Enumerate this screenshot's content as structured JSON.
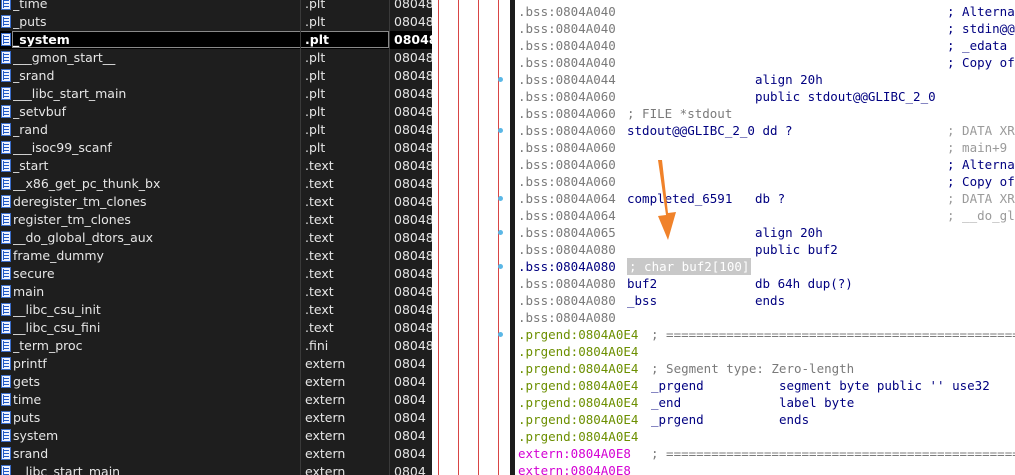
{
  "functions": [
    {
      "name": "_time",
      "segment": ".plt",
      "address": "08048"
    },
    {
      "name": "_puts",
      "segment": ".plt",
      "address": "08048"
    },
    {
      "name": "_system",
      "segment": ".plt",
      "address": "08048",
      "selected": true
    },
    {
      "name": "___gmon_start__",
      "segment": ".plt",
      "address": "08048"
    },
    {
      "name": "_srand",
      "segment": ".plt",
      "address": "08048"
    },
    {
      "name": "___libc_start_main",
      "segment": ".plt",
      "address": "08048"
    },
    {
      "name": "_setvbuf",
      "segment": ".plt",
      "address": "08048"
    },
    {
      "name": "_rand",
      "segment": ".plt",
      "address": "08048"
    },
    {
      "name": "___isoc99_scanf",
      "segment": ".plt",
      "address": "08048"
    },
    {
      "name": "_start",
      "segment": ".text",
      "address": "08048"
    },
    {
      "name": "__x86_get_pc_thunk_bx",
      "segment": ".text",
      "address": "08048"
    },
    {
      "name": "deregister_tm_clones",
      "segment": ".text",
      "address": "08048"
    },
    {
      "name": "register_tm_clones",
      "segment": ".text",
      "address": "08048"
    },
    {
      "name": "__do_global_dtors_aux",
      "segment": ".text",
      "address": "08048"
    },
    {
      "name": "frame_dummy",
      "segment": ".text",
      "address": "08048"
    },
    {
      "name": "secure",
      "segment": ".text",
      "address": "08048"
    },
    {
      "name": "main",
      "segment": ".text",
      "address": "08048"
    },
    {
      "name": "__libc_csu_init",
      "segment": ".text",
      "address": "08048"
    },
    {
      "name": "__libc_csu_fini",
      "segment": ".text",
      "address": "08048"
    },
    {
      "name": "_term_proc",
      "segment": ".fini",
      "address": "08048"
    },
    {
      "name": "printf",
      "segment": "extern",
      "address": "0804"
    },
    {
      "name": "gets",
      "segment": "extern",
      "address": "0804"
    },
    {
      "name": "time",
      "segment": "extern",
      "address": "0804"
    },
    {
      "name": "puts",
      "segment": "extern",
      "address": "0804"
    },
    {
      "name": "system",
      "segment": "extern",
      "address": "0804"
    },
    {
      "name": "srand",
      "segment": "extern",
      "address": "0804"
    },
    {
      "name": "__libc_start_main",
      "segment": "extern",
      "address": "0804"
    }
  ],
  "listing": [
    {
      "addr": ".bss:0804A040",
      "kind": "bss",
      "cmt": "; Alterna"
    },
    {
      "addr": ".bss:0804A040",
      "kind": "bss",
      "cmt": "; stdin@@"
    },
    {
      "addr": ".bss:0804A040",
      "kind": "bss",
      "cmt": "; _edata"
    },
    {
      "addr": ".bss:0804A040",
      "kind": "bss",
      "cmt": "; Copy of"
    },
    {
      "addr": ".bss:0804A044",
      "kind": "bss",
      "op": "align 20h"
    },
    {
      "addr": ".bss:0804A060",
      "kind": "bss",
      "op": "public stdout@@GLIBC_2_0"
    },
    {
      "addr": ".bss:0804A060",
      "kind": "bss",
      "grey": "; FILE *stdout"
    },
    {
      "addr": ".bss:0804A060",
      "kind": "bss",
      "name": "stdout@@GLIBC_2_0 dd ?",
      "cmt2": "; DATA XR"
    },
    {
      "addr": ".bss:0804A060",
      "kind": "bss",
      "cmt2": "; main+9"
    },
    {
      "addr": ".bss:0804A060",
      "kind": "bss",
      "cmt": "; Alterna"
    },
    {
      "addr": ".bss:0804A060",
      "kind": "bss",
      "cmt": "; Copy of"
    },
    {
      "addr": ".bss:0804A064",
      "kind": "bss",
      "name": "completed_6591",
      "op": "db ?",
      "cmt2": "; DATA XR"
    },
    {
      "addr": ".bss:0804A064",
      "kind": "bss",
      "cmt2": "; __do_gl"
    },
    {
      "addr": ".bss:0804A065",
      "kind": "bss",
      "op": "align 20h"
    },
    {
      "addr": ".bss:0804A080",
      "kind": "bss",
      "op": "public buf2"
    },
    {
      "addr": ".bss:0804A080",
      "kind": "cur",
      "hl": "; char buf2[100]"
    },
    {
      "addr": ".bss:0804A080",
      "kind": "bss",
      "name": "buf2",
      "op": "db 64h dup(?)"
    },
    {
      "addr": ".bss:0804A080",
      "kind": "bss",
      "name": "_bss",
      "op": "ends"
    },
    {
      "addr": ".bss:0804A080",
      "kind": "bss"
    },
    {
      "addr": ".prgend:0804A0E4",
      "kind": "prg",
      "sep": "; ==================================================="
    },
    {
      "addr": ".prgend:0804A0E4",
      "kind": "prg"
    },
    {
      "addr": ".prgend:0804A0E4",
      "kind": "prg",
      "sepgrey": "; Segment type: Zero-length"
    },
    {
      "addr": ".prgend:0804A0E4",
      "kind": "prg",
      "name2": "_prgend",
      "op2": "segment byte public '' use32"
    },
    {
      "addr": ".prgend:0804A0E4",
      "kind": "prg",
      "name2": "_end",
      "op2": "label byte"
    },
    {
      "addr": ".prgend:0804A0E4",
      "kind": "prg",
      "name2": "_prgend",
      "op2": "ends"
    },
    {
      "addr": ".prgend:0804A0E4",
      "kind": "prg"
    },
    {
      "addr": "extern:0804A0E8",
      "kind": "ext",
      "sep": "; ==================================================="
    },
    {
      "addr": "extern:0804A0E8",
      "kind": "ext"
    }
  ],
  "colors": {
    "panel_bg": "#1e1e1e",
    "bss_addr": "#7a7a7a",
    "prgend_addr": "#6c8f00",
    "extern_addr": "#d400d4",
    "code": "#000080",
    "arrow": "#f0822a"
  }
}
